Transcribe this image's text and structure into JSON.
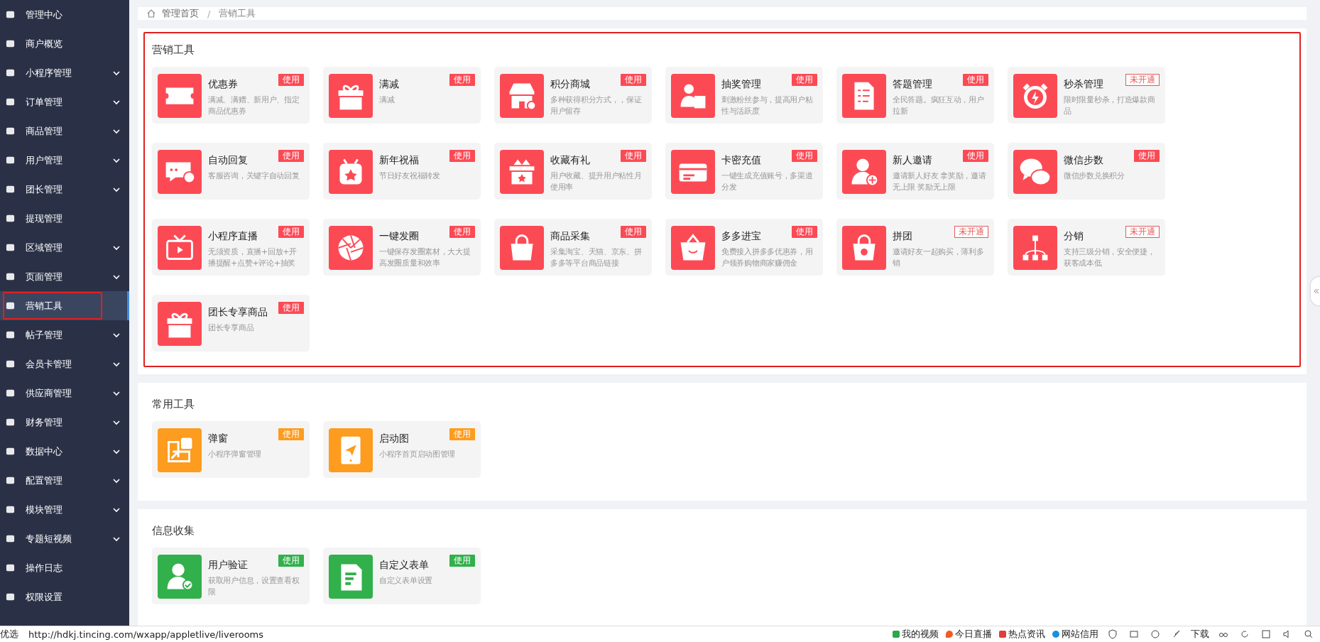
{
  "sidebar": {
    "items": [
      {
        "label": "管理中心",
        "expandable": false,
        "selected": false,
        "highlighted": false
      },
      {
        "label": "商户概览",
        "expandable": false,
        "selected": false,
        "highlighted": false
      },
      {
        "label": "小程序管理",
        "expandable": true,
        "selected": false,
        "highlighted": false
      },
      {
        "label": "订单管理",
        "expandable": true,
        "selected": false,
        "highlighted": false
      },
      {
        "label": "商品管理",
        "expandable": true,
        "selected": false,
        "highlighted": false
      },
      {
        "label": "用户管理",
        "expandable": true,
        "selected": false,
        "highlighted": false
      },
      {
        "label": "团长管理",
        "expandable": true,
        "selected": false,
        "highlighted": false
      },
      {
        "label": "提现管理",
        "expandable": false,
        "selected": false,
        "highlighted": false
      },
      {
        "label": "区域管理",
        "expandable": true,
        "selected": false,
        "highlighted": false
      },
      {
        "label": "页面管理",
        "expandable": true,
        "selected": false,
        "highlighted": false
      },
      {
        "label": "营销工具",
        "expandable": false,
        "selected": true,
        "highlighted": true
      },
      {
        "label": "帖子管理",
        "expandable": true,
        "selected": false,
        "highlighted": false
      },
      {
        "label": "会员卡管理",
        "expandable": true,
        "selected": false,
        "highlighted": false
      },
      {
        "label": "供应商管理",
        "expandable": true,
        "selected": false,
        "highlighted": false
      },
      {
        "label": "财务管理",
        "expandable": true,
        "selected": false,
        "highlighted": false
      },
      {
        "label": "数据中心",
        "expandable": true,
        "selected": false,
        "highlighted": false
      },
      {
        "label": "配置管理",
        "expandable": true,
        "selected": false,
        "highlighted": false
      },
      {
        "label": "模块管理",
        "expandable": true,
        "selected": false,
        "highlighted": false
      },
      {
        "label": "专题短视频",
        "expandable": true,
        "selected": false,
        "highlighted": false
      },
      {
        "label": "操作日志",
        "expandable": false,
        "selected": false,
        "highlighted": false
      },
      {
        "label": "权限设置",
        "expandable": false,
        "selected": false,
        "highlighted": false
      }
    ]
  },
  "breadcrumb": [
    "管理首页",
    "营销工具"
  ],
  "breadcrumb_separator": "/",
  "sections": [
    {
      "title": "营销工具",
      "color": "#fc4a55",
      "highlighted": true,
      "cards": [
        {
          "title": "优惠券",
          "description": "满减、满赠、新用户、指定商品优惠券",
          "badge": "使用",
          "enabled": true
        },
        {
          "title": "满减",
          "description": "满减",
          "badge": "使用",
          "enabled": true
        },
        {
          "title": "积分商城",
          "description": "多种获得积分方式，，保证用户留存",
          "badge": "使用",
          "enabled": true
        },
        {
          "title": "抽奖管理",
          "description": "刺激粉丝参与，提高用户粘性与活跃度",
          "badge": "使用",
          "enabled": true
        },
        {
          "title": "答题管理",
          "description": "全民答题。疯狂互动，用户拉新",
          "badge": "使用",
          "enabled": true
        },
        {
          "title": "秒杀管理",
          "description": "限时限量秒杀，打造爆款商品",
          "badge": "未开通",
          "enabled": false
        },
        {
          "title": "自动回复",
          "description": "客服咨询，关键字自动回复",
          "badge": "使用",
          "enabled": true
        },
        {
          "title": "新年祝福",
          "description": "节日好友祝福转发",
          "badge": "使用",
          "enabled": true
        },
        {
          "title": "收藏有礼",
          "description": "用户收藏、提升用户粘性月使用率",
          "badge": "使用",
          "enabled": true
        },
        {
          "title": "卡密充值",
          "description": "一键生成充值账号，多渠道分发",
          "badge": "使用",
          "enabled": true
        },
        {
          "title": "新人邀请",
          "description": "邀请新人好友 拿奖励，邀请无上限 奖励无上限",
          "badge": "使用",
          "enabled": true
        },
        {
          "title": "微信步数",
          "description": "微信步数兑换积分",
          "badge": "使用",
          "enabled": true
        },
        {
          "title": "小程序直播",
          "description": "无须资质，直播+回放+开播提醒+点赞+评论+抽奖",
          "badge": "使用",
          "enabled": true
        },
        {
          "title": "一键发圈",
          "description": "一键保存发圈素材，大大提高发圈质量和效率",
          "badge": "使用",
          "enabled": true
        },
        {
          "title": "商品采集",
          "description": "采集淘宝、天猫、京东、拼多多等平台商品链接",
          "badge": "使用",
          "enabled": true
        },
        {
          "title": "多多进宝",
          "description": "免费接入拼多多优惠券，用户领券购物商家赚佣金",
          "badge": "使用",
          "enabled": true
        },
        {
          "title": "拼团",
          "description": "邀请好友一起购买，薄利多销",
          "badge": "未开通",
          "enabled": false
        },
        {
          "title": "分销",
          "description": "支持三级分销，安全便捷，获客成本低",
          "badge": "未开通",
          "enabled": false
        },
        {
          "title": "团长专享商品",
          "description": "团长专享商品",
          "badge": "使用",
          "enabled": true
        }
      ]
    },
    {
      "title": "常用工具",
      "color": "#fd9c1e",
      "highlighted": false,
      "cards": [
        {
          "title": "弹窗",
          "description": "小程序弹窗管理",
          "badge": "使用",
          "enabled": true
        },
        {
          "title": "启动图",
          "description": "小程序首页启动图管理",
          "badge": "使用",
          "enabled": true
        }
      ]
    },
    {
      "title": "信息收集",
      "color": "#31b04b",
      "highlighted": false,
      "cards": [
        {
          "title": "用户验证",
          "description": "获取用户信息，设置查看权限",
          "badge": "使用",
          "enabled": true
        },
        {
          "title": "自定义表单",
          "description": "自定义表单设置",
          "badge": "使用",
          "enabled": true
        }
      ]
    }
  ],
  "status_bar": {
    "prefix": "优选",
    "url": "http://hdkj.tincing.com/wxapp/appletlive/liverooms",
    "links": [
      "我的视频",
      "今日直播",
      "热点资讯",
      "网站信用"
    ],
    "download": "下载"
  }
}
